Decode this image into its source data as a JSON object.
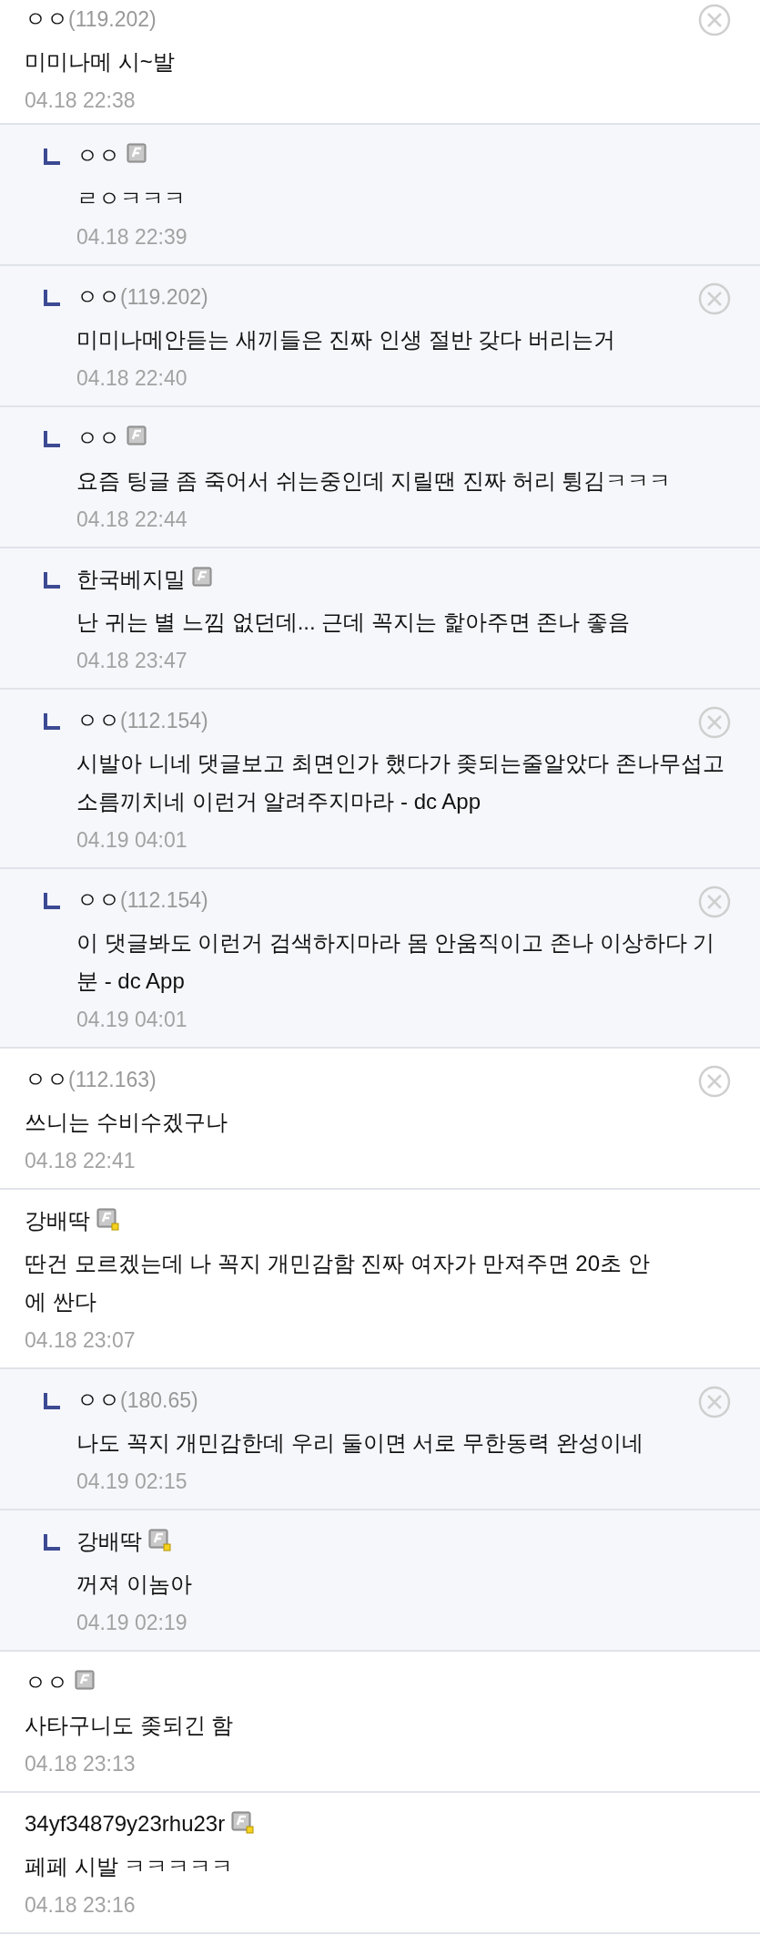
{
  "comments": [
    {
      "reply": false,
      "name": "ㅇㅇ",
      "ip": "(119.202)",
      "kind": "anonymous",
      "body": "미미나메 시~발",
      "date": "04.18 22:38",
      "deletable": true
    },
    {
      "reply": true,
      "name": "ㅇㅇ",
      "kind": "plain",
      "body": "ㄹㅇㅋㅋㅋ",
      "date": "04.18 22:39",
      "deletable": false
    },
    {
      "reply": true,
      "name": "ㅇㅇ",
      "ip": "(119.202)",
      "kind": "anonymous",
      "body": "미미나메안듣는 새끼들은 진짜 인생 절반 갖다 버리는거",
      "date": "04.18 22:40",
      "deletable": true
    },
    {
      "reply": true,
      "name": "ㅇㅇ",
      "kind": "plain",
      "body": "요즘 팅글 좀 죽어서 쉬는중인데 지릴땐 진짜 허리 튕김ㅋㅋㅋ",
      "date": "04.18 22:44",
      "deletable": false
    },
    {
      "reply": true,
      "name": "한국베지밀",
      "kind": "plain",
      "body": "난 귀는 별 느낌 없던데... 근데 꼭지는 핥아주면 존나 좋음",
      "date": "04.18 23:47",
      "deletable": false
    },
    {
      "reply": true,
      "name": "ㅇㅇ",
      "ip": "(112.154)",
      "kind": "anonymous",
      "body": "시발아 니네 댓글보고 최면인가 했다가 좆되는줄알았다 존나무섭고 소름끼치네 이런거 알려주지마라 - dc App",
      "date": "04.19 04:01",
      "deletable": true
    },
    {
      "reply": true,
      "name": "ㅇㅇ",
      "ip": "(112.154)",
      "kind": "anonymous",
      "body": "이 댓글봐도 이런거 검색하지마라 몸 안움직이고 존나 이상하다 기분 - dc App",
      "date": "04.19 04:01",
      "deletable": true
    },
    {
      "reply": false,
      "name": "ㅇㅇ",
      "ip": "(112.163)",
      "kind": "anonymous",
      "body": "쓰니는 수비수겠구나",
      "date": "04.18 22:41",
      "deletable": true
    },
    {
      "reply": false,
      "name": "강배딱",
      "kind": "dot",
      "body": "딴건 모르겠는데 나 꼭지 개민감함 진짜 여자가 만져주면 20초 안에 싼다",
      "date": "04.18 23:07",
      "deletable": false
    },
    {
      "reply": true,
      "name": "ㅇㅇ",
      "ip": "(180.65)",
      "kind": "anonymous",
      "body": "나도 꼭지 개민감한데 우리 둘이면 서로 무한동력 완성이네",
      "date": "04.19 02:15",
      "deletable": true
    },
    {
      "reply": true,
      "name": "강배딱",
      "kind": "dot",
      "body": "꺼져 이놈아",
      "date": "04.19 02:19",
      "deletable": false
    },
    {
      "reply": false,
      "name": "ㅇㅇ",
      "kind": "plain",
      "body": "사타구니도 좆되긴 함",
      "date": "04.18 23:13",
      "deletable": false
    },
    {
      "reply": false,
      "name": "34yf34879y23rhu23r",
      "kind": "dot",
      "body": "페페 시발 ㅋㅋㅋㅋㅋ",
      "date": "04.18 23:16",
      "deletable": false
    }
  ]
}
